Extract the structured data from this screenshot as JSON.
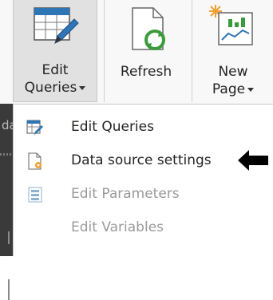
{
  "ribbon": {
    "edit_queries": {
      "line1": "Edit",
      "line2": "Queries"
    },
    "refresh": {
      "label": "Refresh"
    },
    "new_page": {
      "line1": "New",
      "line2": "Page"
    }
  },
  "left_strip_text": "da",
  "menu": {
    "items": [
      {
        "label": "Edit Queries",
        "enabled": true,
        "icon": "edit-queries-icon"
      },
      {
        "label": "Data source settings",
        "enabled": true,
        "icon": "data-source-settings-icon"
      },
      {
        "label": "Edit Parameters",
        "enabled": false,
        "icon": "edit-parameters-icon"
      },
      {
        "label": "Edit Variables",
        "enabled": false,
        "icon": "edit-variables-icon"
      }
    ]
  },
  "colors": {
    "ribbon_bg": "#f8f8f8",
    "selected_button_bg": "#e1e1e1",
    "accent_blue": "#2e75b6",
    "accent_green": "#3a9b3a",
    "accent_orange": "#f0a030",
    "disabled_text": "#9a9a9a"
  }
}
